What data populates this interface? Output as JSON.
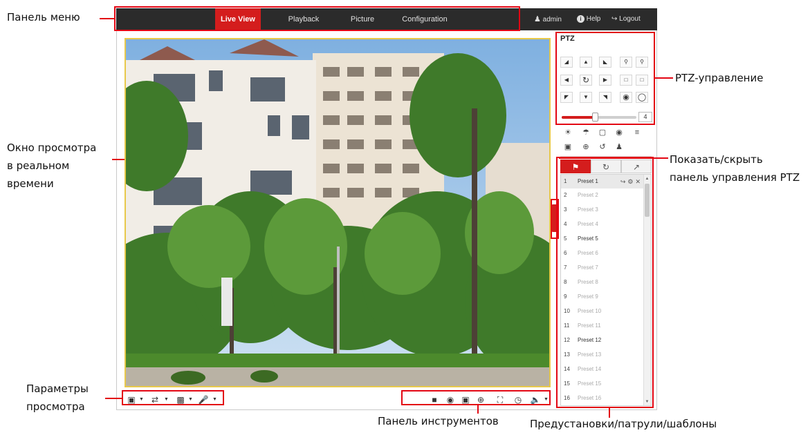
{
  "callouts": {
    "menu_bar": "Панель меню",
    "ptz_control": "PTZ-управление",
    "live_window_1": "Окно просмотра",
    "live_window_2": "в реальном",
    "live_window_3": "времени",
    "toggle_ptz_1": "Показать/скрыть",
    "toggle_ptz_2": "панель управления PTZ",
    "view_params_1": "Параметры",
    "view_params_2": "просмотра",
    "toolbar": "Панель инструментов",
    "presets": "Предустановки/патрули/шаблоны"
  },
  "menu": {
    "tabs": [
      "Live View",
      "Playback",
      "Picture",
      "Configuration"
    ],
    "active": "Live View",
    "user": "admin",
    "help": "Help",
    "logout": "Logout"
  },
  "ptz": {
    "title": "PTZ",
    "speed": "4",
    "speed_level_fraction": 0.43
  },
  "presets": [
    {
      "num": "1",
      "label": "Preset 1"
    },
    {
      "num": "2",
      "label": "Preset 2"
    },
    {
      "num": "3",
      "label": "Preset 3"
    },
    {
      "num": "4",
      "label": "Preset 4"
    },
    {
      "num": "5",
      "label": "Preset 5"
    },
    {
      "num": "6",
      "label": "Preset 6"
    },
    {
      "num": "7",
      "label": "Preset 7"
    },
    {
      "num": "8",
      "label": "Preset 8"
    },
    {
      "num": "9",
      "label": "Preset 9"
    },
    {
      "num": "10",
      "label": "Preset 10"
    },
    {
      "num": "11",
      "label": "Preset 11"
    },
    {
      "num": "12",
      "label": "Preset 12"
    },
    {
      "num": "13",
      "label": "Preset 13"
    },
    {
      "num": "14",
      "label": "Preset 14"
    },
    {
      "num": "15",
      "label": "Preset 15"
    },
    {
      "num": "16",
      "label": "Preset 16"
    }
  ],
  "colors": {
    "accent": "#d41d1d",
    "menubar": "#2b2b2b",
    "highlight": "#e30613",
    "viewport_border": "#e8c94a"
  }
}
